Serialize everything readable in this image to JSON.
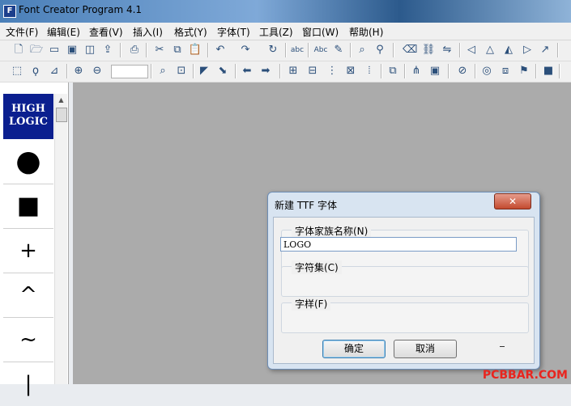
{
  "window": {
    "title": "Font Creator Program 4.1",
    "icon": "app-icon"
  },
  "menu": [
    "文件(F)",
    "编辑(E)",
    "查看(V)",
    "插入(I)",
    "格式(Y)",
    "字体(T)",
    "工具(Z)",
    "窗口(W)",
    "帮助(H)"
  ],
  "toolbar1_icons": [
    "new-icon",
    "open-icon",
    "open-folder-icon",
    "save-icon",
    "save-all-icon",
    "export-icon",
    "print-icon",
    "cut-icon",
    "copy-icon",
    "paste-icon",
    "undo-icon",
    "redo-icon",
    "refresh-icon",
    "abc-icon",
    "spell-icon",
    "pen-icon",
    "search-icon",
    "replace-icon",
    "eraser-icon",
    "link-icon",
    "unlink-icon",
    "flip-icon",
    "triangle-icon",
    "triangle2-icon",
    "arrow-icon"
  ],
  "toolbar2_icons": [
    "select-icon",
    "lasso-icon",
    "measure-icon",
    "zoom-in-icon",
    "zoom-out-icon",
    "magnify-icon",
    "fit-icon",
    "pointer-icon",
    "pointer2-icon",
    "left-arrow-icon",
    "right-arrow-icon",
    "grid-icon",
    "grid2-icon",
    "grid3-icon",
    "grid4-icon",
    "grid5-icon",
    "node-icon",
    "tree-icon",
    "box-icon",
    "compass-icon",
    "circle-icon",
    "shapes-icon",
    "flag-icon",
    "stop-icon"
  ],
  "glyphs": {
    "logo_line1": "HIGH",
    "logo_line2": "LOGIC",
    "items": [
      "●",
      "■",
      "+",
      "^",
      "~",
      "|"
    ]
  },
  "dialog": {
    "title": "新建 TTF 字体",
    "close_label": "✕",
    "family_label": "字体家族名称(N)",
    "family_value": "LOGO",
    "charset_label": "字符集(C)",
    "style_label": "字样(F)",
    "ok_label": "确定",
    "cancel_label": "取消"
  },
  "watermark": "PCBBAR.COM"
}
